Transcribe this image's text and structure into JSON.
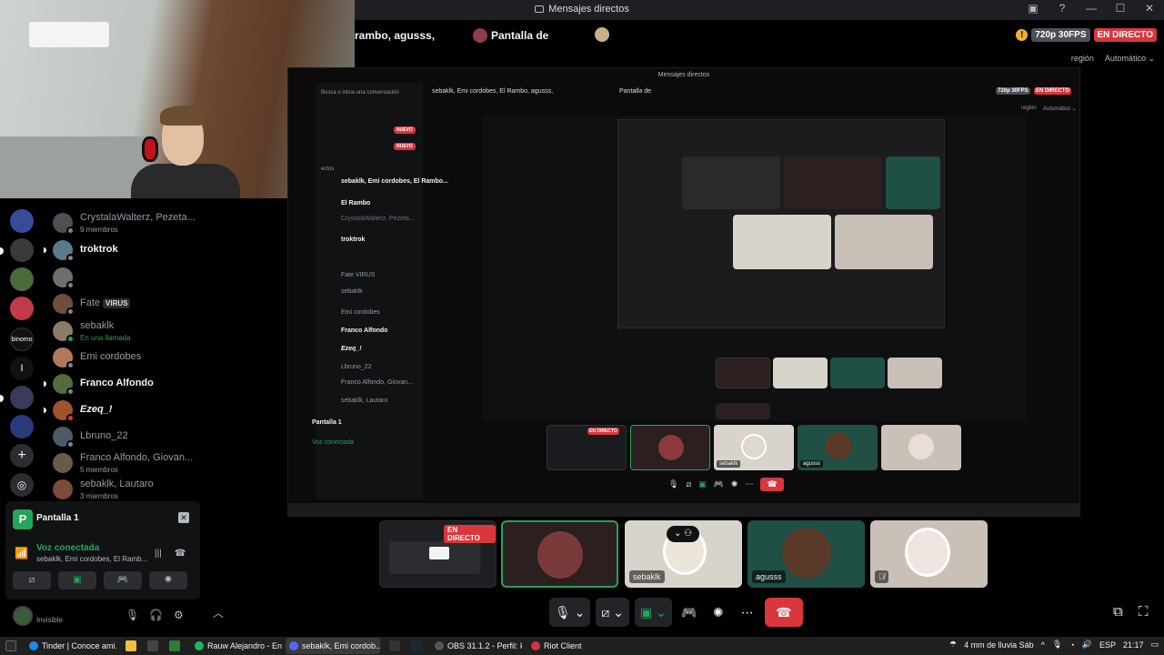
{
  "window": {
    "title": "Mensajes directos",
    "controls": [
      "?",
      "—",
      "☐",
      "✕"
    ]
  },
  "stream_header": {
    "group_label": "rambo, agusss,",
    "screen_label": "Pantalla de",
    "quality_badge": "720p 30FPS",
    "live_badge": "EN DIRECTO",
    "region_label": "región",
    "quality_select": "Automático ⌄"
  },
  "dm_list": [
    {
      "name": "CrystalaWalterz, Pezeta...",
      "sub": "9 miembros",
      "style": "muted",
      "color": "#4e5058"
    },
    {
      "name": "troktrok",
      "sub": "",
      "style": "bold",
      "color": "#5b7a8a",
      "pip": true
    },
    {
      "name": "",
      "sub": "",
      "style": "muted",
      "color": "#6f6f6f"
    },
    {
      "name": "Fate",
      "tag": "VIRUS",
      "sub": "",
      "style": "muted",
      "color": "#6d4f3f"
    },
    {
      "name": "sebaklk",
      "sub": "En una llamada",
      "style": "muted",
      "color": "#8a7b6b",
      "subgreen": true
    },
    {
      "name": "Emi cordobes",
      "sub": "",
      "style": "muted",
      "color": "#b07a5a"
    },
    {
      "name": "Franco Alfondo",
      "sub": "",
      "style": "bold",
      "color": "#556b3f",
      "pip": true
    },
    {
      "name": "Ezeq_!",
      "sub": "",
      "style": "bolditalic",
      "color": "#a0522d",
      "pip": true
    },
    {
      "name": "Lbruno_22",
      "sub": "",
      "style": "muted",
      "color": "#4d5a6a"
    },
    {
      "name": "Franco Alfondo, Giovan...",
      "sub": "5 miembros",
      "style": "muted",
      "color": "#6a5a4a"
    },
    {
      "name": "sebaklk, Lautaro",
      "sub": "3 miembros",
      "style": "muted",
      "color": "#7a4a3a"
    }
  ],
  "voice_panel": {
    "app_name": "Pantalla 1",
    "status": "Voz conectada",
    "members": "sebaklk, Emi cordobes, El Ramb..."
  },
  "user_bar": {
    "status": "Invisible"
  },
  "inner": {
    "title": "Mensajes directos",
    "header_text": "sebaklk, Emi cordobes, El Rambo, agusss,",
    "screen_label": "Pantalla de",
    "quality_badge": "720p 30FPS",
    "live_badge": "EN DIRECTO",
    "region_label": "región",
    "quality_select": "Automático ⌄",
    "search_hint": "Busca o inicia una conversación",
    "nuevo": "NUEVO",
    "section": "ectos",
    "dms": [
      {
        "name": "sebaklk, Emi cordobes, El Rambo...",
        "bold": true
      },
      {
        "name": "El Rambo",
        "bold": true
      },
      {
        "name": "CrystalaWalterz, Pezeta...",
        "bold": false
      },
      {
        "name": "troktrok",
        "bold": true
      },
      {
        "name": "",
        "bold": false
      },
      {
        "name": "Fate VIRUS",
        "bold": false
      },
      {
        "name": "sebaklk",
        "bold": false
      },
      {
        "name": "Emi cordobes",
        "bold": false
      },
      {
        "name": "Franco Alfondo",
        "bold": true
      },
      {
        "name": "Ezeq_!",
        "bold": true
      },
      {
        "name": "Lbruno_22",
        "bold": false
      },
      {
        "name": "Franco Alfondo, Giovan...",
        "bold": false
      },
      {
        "name": "sebaklk, Lautaro",
        "bold": false
      }
    ],
    "voice_name": "Pantalla 1",
    "voice_status": "Voz conectada",
    "tiles": [
      {
        "label": "EN DIRECTO"
      },
      {
        "label": ""
      },
      {
        "label": "sebaklk"
      },
      {
        "label": "agusss"
      },
      {
        "label": ""
      }
    ]
  },
  "bottom_tiles": [
    {
      "label": "",
      "live": "EN DIRECTO",
      "bg": "#1e1f22"
    },
    {
      "label": "",
      "bg": "#2b1f1f",
      "selected": true
    },
    {
      "label": "sebaklk",
      "bg": "#d8d4cc"
    },
    {
      "label": "agusss",
      "bg": "#1f4f45"
    },
    {
      "label": "",
      "bg": "#c9c1b8"
    }
  ],
  "taskbar": {
    "items": [
      {
        "label": "Tinder | Conoce ami...",
        "color": "#1e88e5"
      },
      {
        "label": "Rauw Alejandro - En...",
        "color": "#1db954"
      },
      {
        "label": "sebaklk, Emi cordob...",
        "color": "#5865f2",
        "active": true
      },
      {
        "label": "OBS 31.1.2 - Perfil: ki...",
        "color": "#444"
      },
      {
        "label": "Riot Client",
        "color": "#d13639"
      }
    ],
    "weather": "4 mm de lluvia Sáb",
    "lang": "ESP",
    "time": "21:17"
  }
}
